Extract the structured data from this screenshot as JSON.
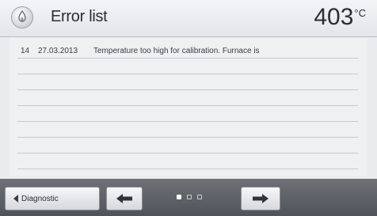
{
  "header": {
    "title": "Error list",
    "temperature": "403",
    "temperature_unit": "°C",
    "icon": "furnace-icon"
  },
  "error_list": {
    "rows": [
      {
        "number": "14",
        "date": "27.03.2013",
        "message": "Temperature too high for calibration. Furnace is"
      },
      {
        "number": "",
        "date": "",
        "message": ""
      },
      {
        "number": "",
        "date": "",
        "message": ""
      },
      {
        "number": "",
        "date": "",
        "message": ""
      },
      {
        "number": "",
        "date": "",
        "message": ""
      },
      {
        "number": "",
        "date": "",
        "message": ""
      },
      {
        "number": "",
        "date": "",
        "message": ""
      },
      {
        "number": "",
        "date": "",
        "message": ""
      }
    ]
  },
  "footer": {
    "diagnostic_label": "Diagnostic",
    "prev_icon": "arrow-left-icon",
    "next_icon": "arrow-right-icon",
    "pages": 3,
    "current_page": 1
  },
  "colors": {
    "header_bg": "#e9ebee",
    "footer_bg": "#5d6166",
    "text": "#2b2d30"
  }
}
